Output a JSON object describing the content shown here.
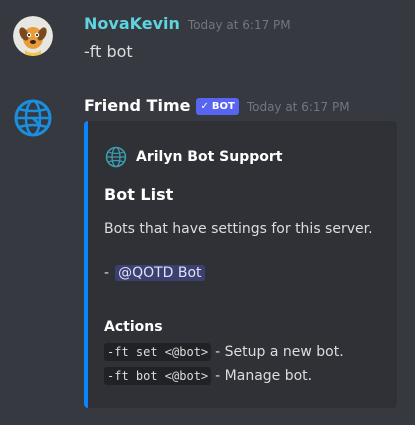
{
  "messages": [
    {
      "username": "NovaKevin",
      "username_color": "#5fd3e0",
      "timestamp": "Today at 6:17 PM",
      "text": "-ft bot",
      "avatar": "dog-avatar-icon"
    },
    {
      "username": "Friend Time",
      "username_color": "#ffffff",
      "bot_badge": "BOT",
      "timestamp": "Today at 6:17 PM",
      "avatar": "globe-avatar-icon",
      "embed": {
        "accent_color": "#0a84ff",
        "author_icon": "globe-icon",
        "author_name": "Arilyn Bot Support",
        "title": "Bot List",
        "description": "Bots that have settings for this server.",
        "list_prefix": "-",
        "list_item": "@QOTD Bot",
        "actions_title": "Actions",
        "actions": [
          {
            "code": "-ft set <@bot>",
            "text": "- Setup a new bot."
          },
          {
            "code": "-ft bot <@bot>",
            "text": "- Manage bot."
          }
        ]
      }
    }
  ]
}
